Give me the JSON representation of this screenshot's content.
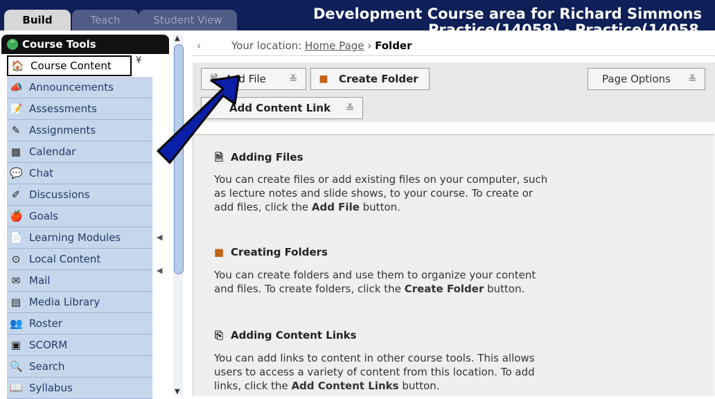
{
  "tabs": {
    "build": "Build",
    "teach": "Teach",
    "student_view": "Student View"
  },
  "course_title_line1": "Development Course area for Richard Simmons",
  "course_title_line2": "Practice(14058) - Practice(14058",
  "sidebar": {
    "header": "Course Tools",
    "items": [
      {
        "label": "Course Content",
        "icon": "home-icon",
        "glyph": "🏠"
      },
      {
        "label": "Announcements",
        "icon": "megaphone-icon",
        "glyph": "📣"
      },
      {
        "label": "Assessments",
        "icon": "assessment-icon",
        "glyph": "📝"
      },
      {
        "label": "Assignments",
        "icon": "assignment-icon",
        "glyph": "✎"
      },
      {
        "label": "Calendar",
        "icon": "calendar-icon",
        "glyph": "▦"
      },
      {
        "label": "Chat",
        "icon": "chat-icon",
        "glyph": "💬"
      },
      {
        "label": "Discussions",
        "icon": "discussion-icon",
        "glyph": "✐"
      },
      {
        "label": "Goals",
        "icon": "goals-icon",
        "glyph": "🍎"
      },
      {
        "label": "Learning Modules",
        "icon": "modules-icon",
        "glyph": "📄"
      },
      {
        "label": "Local Content",
        "icon": "local-content-icon",
        "glyph": "⊙"
      },
      {
        "label": "Mail",
        "icon": "mail-icon",
        "glyph": "✉"
      },
      {
        "label": "Media Library",
        "icon": "media-library-icon",
        "glyph": "▤"
      },
      {
        "label": "Roster",
        "icon": "roster-icon",
        "glyph": "👥"
      },
      {
        "label": "SCORM",
        "icon": "scorm-icon",
        "glyph": "▣"
      },
      {
        "label": "Search",
        "icon": "search-icon",
        "glyph": "🔍"
      },
      {
        "label": "Syllabus",
        "icon": "syllabus-icon",
        "glyph": "📖"
      }
    ]
  },
  "breadcrumb": {
    "prefix": "Your location:",
    "home": "Home Page",
    "separator": "›",
    "current": "Folder"
  },
  "toolbar": {
    "add_file": "Add File",
    "create_folder": "Create Folder",
    "page_options": "Page Options",
    "add_content_link": "Add Content Link",
    "dropdown_glyph": "≚"
  },
  "sections": {
    "adding_files": {
      "title": "Adding Files",
      "line1": "You can create files or add existing files on your computer, such",
      "line2": "as lecture notes and slide shows, to your course. To create or",
      "line3_pre": "add files, click the ",
      "line3_bold": "Add File",
      "line3_post": " button."
    },
    "creating_folders": {
      "title": "Creating Folders",
      "line1": "You can create folders and use them to organize your content",
      "line2_pre": "and files. To create folders, click the ",
      "line2_bold": "Create Folder",
      "line2_post": " button."
    },
    "adding_links": {
      "title": "Adding Content Links",
      "line1": "You can add links to content in other course tools. This allows",
      "line2": "users to access a variety of content from this location. To add",
      "line3_pre": "links, click the ",
      "line3_bold": "Add Content Links",
      "line3_post": " button."
    }
  },
  "colors": {
    "topbar": "#0f1f57",
    "sidebar_item": "#c6d7ec",
    "arrow_fill": "#0a1fa8"
  }
}
